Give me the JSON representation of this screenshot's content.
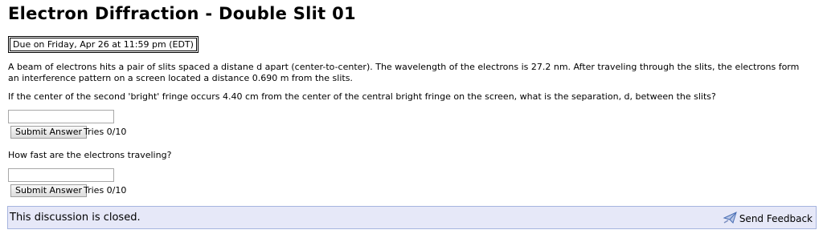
{
  "page": {
    "title": "Electron Diffraction - Double Slit 01",
    "due": "Due on Friday, Apr 26 at 11:59 pm (EDT)"
  },
  "problem": {
    "intro": "A beam of electrons hits a pair of slits spaced a distane d apart (center-to-center). The wavelength of the electrons is 27.2 nm. After traveling through the slits, the electrons form an interference pattern on a screen located a distance 0.690 m from the slits.",
    "questions": [
      {
        "text": "If the center of the second 'bright' fringe occurs 4.40 cm from the center of the central bright fringe on the screen, what is the separation, d, between the slits?",
        "answer_value": "",
        "submit_label": "Submit Answer",
        "tries": "Tries 0/10"
      },
      {
        "text": "How fast are the electrons traveling?",
        "answer_value": "",
        "submit_label": "Submit Answer",
        "tries": "Tries 0/10"
      }
    ]
  },
  "discussion": {
    "status": "This discussion is closed.",
    "feedback_label": "Send Feedback",
    "feedback_icon": "send-feedback-icon"
  },
  "colors": {
    "discussion_bg": "#e6e8f8",
    "discussion_border": "#a6b4df",
    "icon_blue": "#4a6fb5"
  }
}
